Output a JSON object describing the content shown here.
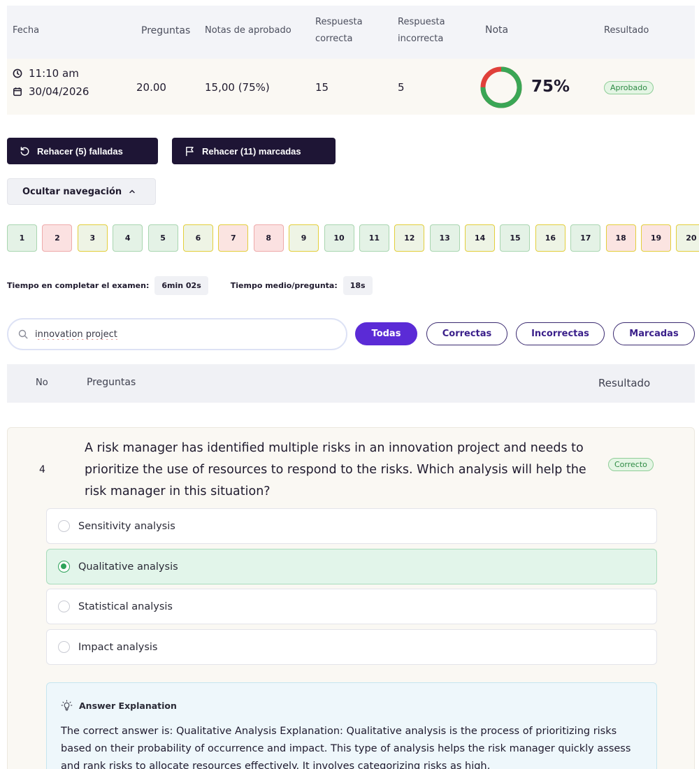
{
  "summary": {
    "headers": {
      "fecha": "Fecha",
      "preguntas": "Preguntas",
      "notas_aprobado": "Notas de aprobado",
      "resp_correcta_1": "Respuesta",
      "resp_correcta_2": "correcta",
      "resp_incorrecta_1": "Respuesta",
      "resp_incorrecta_2": "incorrecta",
      "nota": "Nota",
      "resultado": "Resultado"
    },
    "row": {
      "time": "11:10 am",
      "date": "30/04/2026",
      "preguntas": "20.00",
      "notas_aprobado": "15,00 (75%)",
      "correctas": "15",
      "incorrectas": "5",
      "nota_pct": "75%",
      "nota_fraction": 0.75,
      "resultado": "Aprobado"
    }
  },
  "actions": {
    "redo_failed": "Rehacer (5) falladas",
    "redo_flagged": "Rehacer (11) marcadas",
    "hide_nav": "Ocultar navegación"
  },
  "navigation": [
    {
      "n": "1",
      "state": "correct"
    },
    {
      "n": "2",
      "state": "incorrect"
    },
    {
      "n": "3",
      "state": "correct-flagged"
    },
    {
      "n": "4",
      "state": "correct"
    },
    {
      "n": "5",
      "state": "correct"
    },
    {
      "n": "6",
      "state": "correct-flagged"
    },
    {
      "n": "7",
      "state": "incorrect-flagged"
    },
    {
      "n": "8",
      "state": "incorrect"
    },
    {
      "n": "9",
      "state": "correct-flagged"
    },
    {
      "n": "10",
      "state": "correct"
    },
    {
      "n": "11",
      "state": "correct"
    },
    {
      "n": "12",
      "state": "correct-flagged"
    },
    {
      "n": "13",
      "state": "correct"
    },
    {
      "n": "14",
      "state": "correct-flagged"
    },
    {
      "n": "15",
      "state": "correct"
    },
    {
      "n": "16",
      "state": "correct-flagged"
    },
    {
      "n": "17",
      "state": "correct"
    },
    {
      "n": "18",
      "state": "incorrect-flagged"
    },
    {
      "n": "19",
      "state": "incorrect-flagged"
    },
    {
      "n": "20",
      "state": "correct-flagged"
    }
  ],
  "timing": {
    "total_label": "Tiempo en completar el examen:",
    "total_value": "6min 02s",
    "avg_label": "Tiempo medio/pregunta:",
    "avg_value": "18s"
  },
  "search": {
    "value": "innovation project",
    "placeholder": ""
  },
  "filters": {
    "all": "Todas",
    "correct": "Correctas",
    "incorrect": "Incorrectas",
    "flagged": "Marcadas"
  },
  "table_header": {
    "no": "No",
    "preguntas": "Preguntas",
    "resultado": "Resultado"
  },
  "question": {
    "number": "4",
    "text": "A risk manager has identified multiple risks in an innovation project and needs to prioritize the use of resources to respond to the risks. Which analysis will help the risk manager in this situation?",
    "result": "Correcto",
    "options": [
      {
        "label": "Sensitivity analysis",
        "selected": false
      },
      {
        "label": "Qualitative analysis",
        "selected": true
      },
      {
        "label": "Statistical analysis",
        "selected": false
      },
      {
        "label": "Impact analysis",
        "selected": false
      }
    ],
    "explanation_title": "Answer Explanation",
    "explanation": "The correct answer is: Qualitative Analysis Explanation: Qualitative analysis is the process of prioritizing risks based on their probability of occurrence and impact. This type of analysis helps the risk manager quickly assess and rank risks to allocate resources effectively. It involves categorizing risks as high,"
  },
  "colors": {
    "accent": "#5b2bd6",
    "dark_button": "#1e1535",
    "gauge_green": "#3aa655",
    "gauge_red": "#e0403a",
    "correct_green": "#2e8b44"
  }
}
